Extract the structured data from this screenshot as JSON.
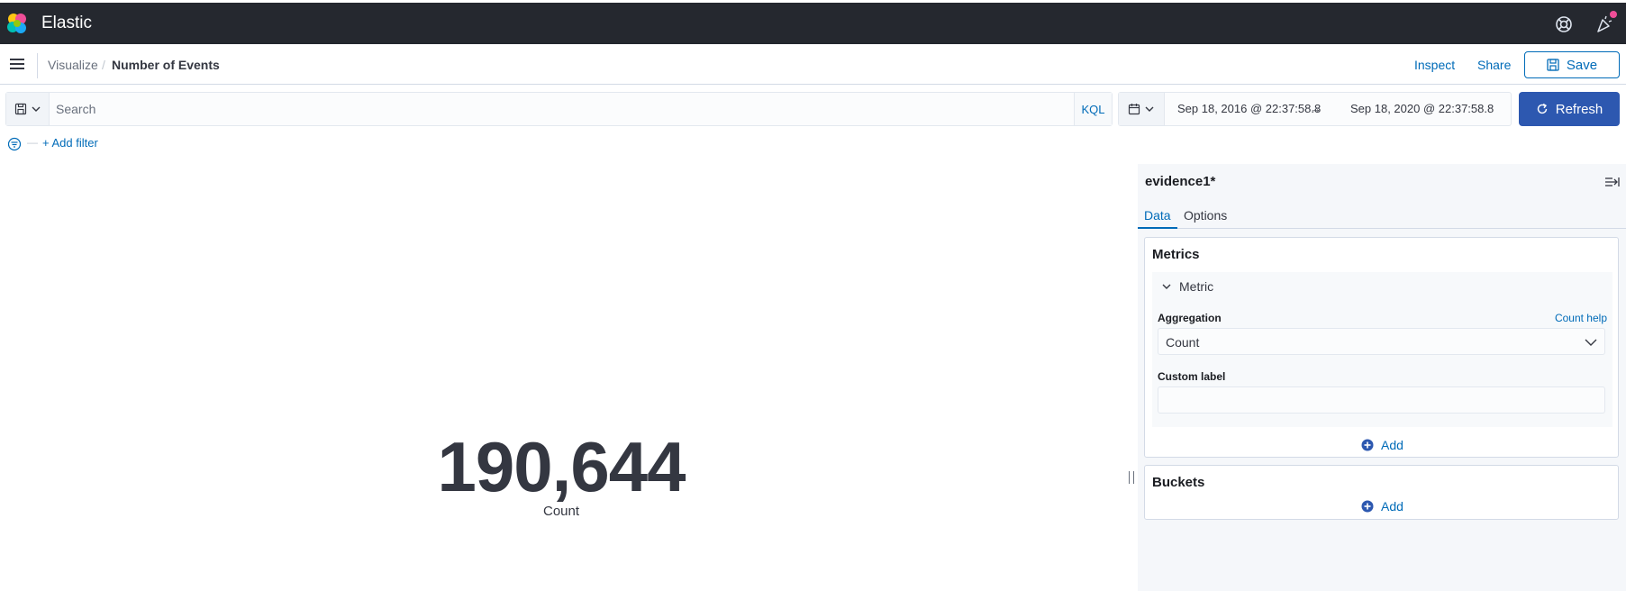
{
  "header": {
    "brand": "Elastic",
    "help_icon": "help-lifebuoy-icon",
    "news_icon": "newsfeed-party-icon",
    "notification_color": "#f04e98"
  },
  "nav": {
    "breadcrumbs": [
      "Visualize",
      "Number of Events"
    ],
    "breadcrumb_separator": "/",
    "inspect_label": "Inspect",
    "share_label": "Share",
    "save_label": "Save"
  },
  "query": {
    "search_placeholder": "Search",
    "search_value": "",
    "language_label": "KQL",
    "date_start": "Sep 18, 2016 @ 22:37:58.8",
    "date_arrow": "→",
    "date_end": "Sep 18, 2020 @ 22:37:58.8",
    "refresh_label": "Refresh",
    "filter_dash": "—",
    "add_filter_label": "+ Add filter"
  },
  "visualization": {
    "metric_value": "190,644",
    "metric_label": "Count"
  },
  "sidebar": {
    "title": "evidence1*",
    "tabs": [
      {
        "label": "Data",
        "active": true
      },
      {
        "label": "Options",
        "active": false
      }
    ],
    "metrics": {
      "title": "Metrics",
      "accordion_label": "Metric",
      "aggregation_label": "Aggregation",
      "help_link": "Count help",
      "aggregation_value": "Count",
      "custom_label_label": "Custom label",
      "custom_label_value": "",
      "add_label": "Add"
    },
    "buckets": {
      "title": "Buckets",
      "add_label": "Add"
    }
  },
  "colors": {
    "header_bg": "#25282f",
    "primary": "#006bb8",
    "refresh_bg": "#2d58b0",
    "text": "#343741",
    "sidebar_bg": "#f5f7fa"
  }
}
